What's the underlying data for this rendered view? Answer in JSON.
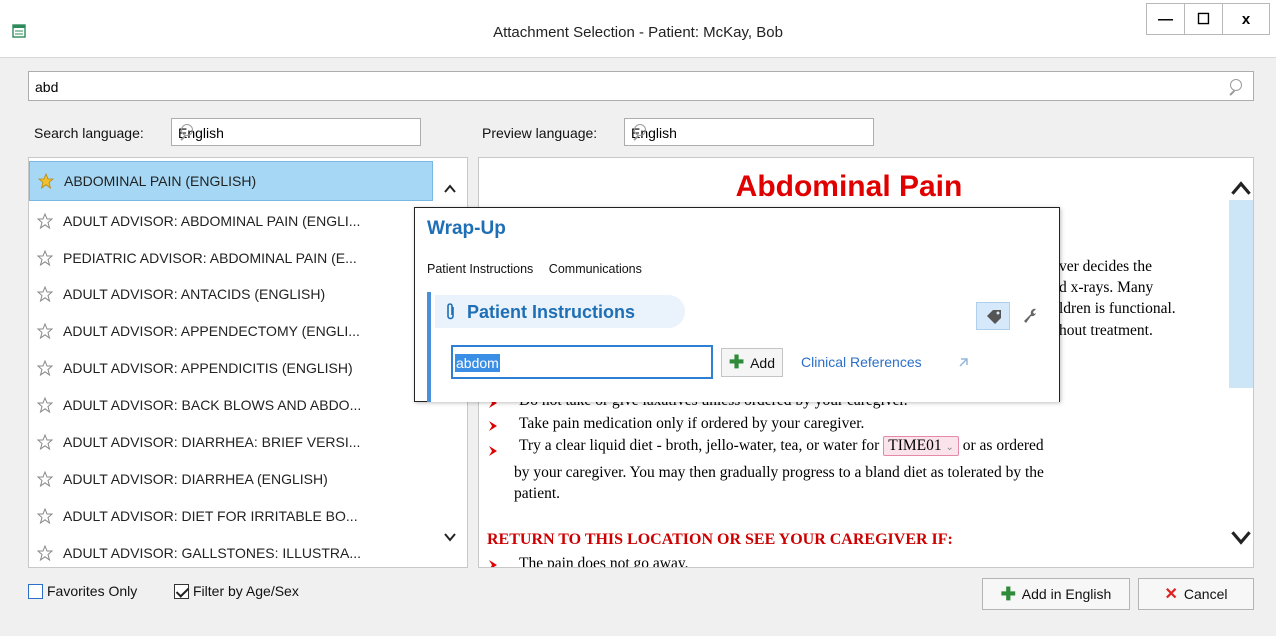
{
  "window": {
    "title": "Attachment Selection - Patient: McKay, Bob",
    "minimize_label": "—",
    "maximize_label": "☐",
    "close_label": "x"
  },
  "search": {
    "value": "abd"
  },
  "search_language": {
    "label": "Search language:",
    "value": "English"
  },
  "preview_language": {
    "label": "Preview language:",
    "value": "English"
  },
  "list": {
    "items": [
      {
        "label": "ABDOMINAL PAIN (ENGLISH)",
        "favorite": true,
        "selected": true
      },
      {
        "label": "ADULT ADVISOR: ABDOMINAL PAIN (ENGLI...",
        "favorite": false
      },
      {
        "label": "PEDIATRIC ADVISOR: ABDOMINAL PAIN (E...",
        "favorite": false
      },
      {
        "label": "ADULT ADVISOR: ANTACIDS (ENGLISH)",
        "favorite": false
      },
      {
        "label": "ADULT ADVISOR: APPENDECTOMY (ENGLI...",
        "favorite": false
      },
      {
        "label": "ADULT ADVISOR: APPENDICITIS (ENGLISH)",
        "favorite": false
      },
      {
        "label": "ADULT ADVISOR: BACK BLOWS AND ABDO...",
        "favorite": false
      },
      {
        "label": "ADULT ADVISOR: DIARRHEA: BRIEF VERSI...",
        "favorite": false
      },
      {
        "label": "ADULT ADVISOR: DIARRHEA (ENGLISH)",
        "favorite": false
      },
      {
        "label": "ADULT ADVISOR: DIET FOR IRRITABLE BO...",
        "favorite": false
      },
      {
        "label": "ADULT ADVISOR: GALLSTONES: ILLUSTRA...",
        "favorite": false
      }
    ]
  },
  "preview": {
    "title": "Abdominal Pain",
    "line1": "ver decides the",
    "line2": "d x-rays. Many",
    "line3": "ldren is functional.",
    "line4": "hout treatment.",
    "bullet1": "Do not take or give laxatives unless ordered by your caregiver.",
    "bullet2": "Take pain medication only if ordered by your caregiver.",
    "bullet3_pre": "Try a clear liquid diet - broth, jello-water, tea, or water for",
    "time_tag": "TIME01",
    "bullet3_post": "or as ordered",
    "bullet3_line2": "by your caregiver. You may then gradually progress to a bland diet as tolerated by the",
    "bullet3_line3": "patient.",
    "return_heading": "RETURN TO THIS LOCATION OR SEE YOUR CAREGIVER IF:",
    "bullet4": "The pain does not go away."
  },
  "wrapup": {
    "title": "Wrap-Up",
    "tabs": [
      "Patient Instructions",
      "Communications"
    ],
    "panel_title": "Patient Instructions",
    "input_value": "abdom",
    "add_label": "Add",
    "link_label": "Clinical References"
  },
  "footer": {
    "favorites_only": "Favorites Only",
    "filter_age_sex": "Filter by Age/Sex",
    "add_button": "Add in English",
    "cancel_button": "Cancel"
  },
  "colors": {
    "accent": "#1e6fb5",
    "selection": "#a6d8f5",
    "preview_heading": "#e00000"
  }
}
